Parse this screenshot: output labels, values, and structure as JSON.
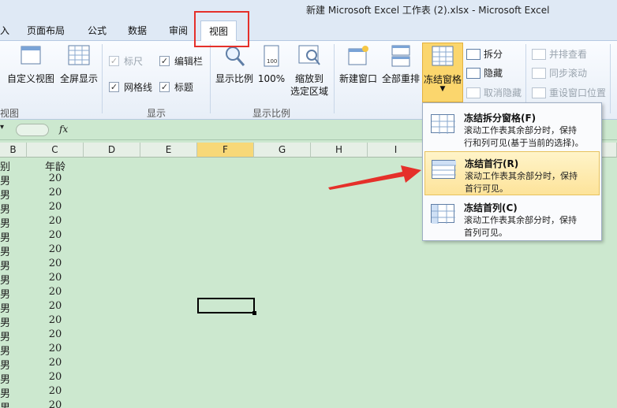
{
  "window": {
    "title": "新建 Microsoft Excel 工作表 (2).xlsx - Microsoft Excel"
  },
  "tabs": [
    {
      "label": "入"
    },
    {
      "label": "页面布局"
    },
    {
      "label": "公式"
    },
    {
      "label": "数据"
    },
    {
      "label": "审阅"
    },
    {
      "label": "视图"
    }
  ],
  "ribbon": {
    "workbook_views": {
      "custom_view": "自定义视图",
      "full_screen": "全屏显示",
      "group_label": "视图"
    },
    "show": {
      "ruler": "标尺",
      "formula_bar": "编辑栏",
      "gridlines": "网格线",
      "headings": "标题",
      "group_label": "显示"
    },
    "zoom": {
      "zoom": "显示比例",
      "zoom_100": "100%",
      "zoom_selection_line1": "缩放到",
      "zoom_selection_line2": "选定区域",
      "group_label": "显示比例"
    },
    "window": {
      "new_window": "新建窗口",
      "arrange_all": "全部重排",
      "freeze_panes": "冻结窗格",
      "split": "拆分",
      "hide": "隐藏",
      "unhide": "取消隐藏",
      "side_by_side": "并排查看",
      "sync_scroll": "同步滚动",
      "reset_position": "重设窗口位置"
    }
  },
  "formula_bar": {
    "fx": "fx"
  },
  "columns": [
    "B",
    "C",
    "D",
    "E",
    "F",
    "G",
    "H",
    "I"
  ],
  "sheet": {
    "header_b": "别",
    "header_c": "年龄",
    "b_value": "男",
    "c_values": [
      "20",
      "20",
      "20",
      "20",
      "20",
      "20",
      "20",
      "20",
      "20",
      "20",
      "20",
      "20",
      "20",
      "20",
      "20",
      "20",
      "20"
    ]
  },
  "freeze_menu": {
    "items": [
      {
        "title": "冻结拆分窗格(F)",
        "desc": "滚动工作表其余部分时，保持\n行和列可见(基于当前的选择)。"
      },
      {
        "title": "冻结首行(R)",
        "desc": "滚动工作表其余部分时，保持\n首行可见。"
      },
      {
        "title": "冻结首列(C)",
        "desc": "滚动工作表其余部分时，保持\n首列可见。"
      }
    ]
  },
  "colors": {
    "accent": "#e5302a",
    "highlight": "#fbd66d",
    "sheet_bg": "#cce8cf"
  }
}
